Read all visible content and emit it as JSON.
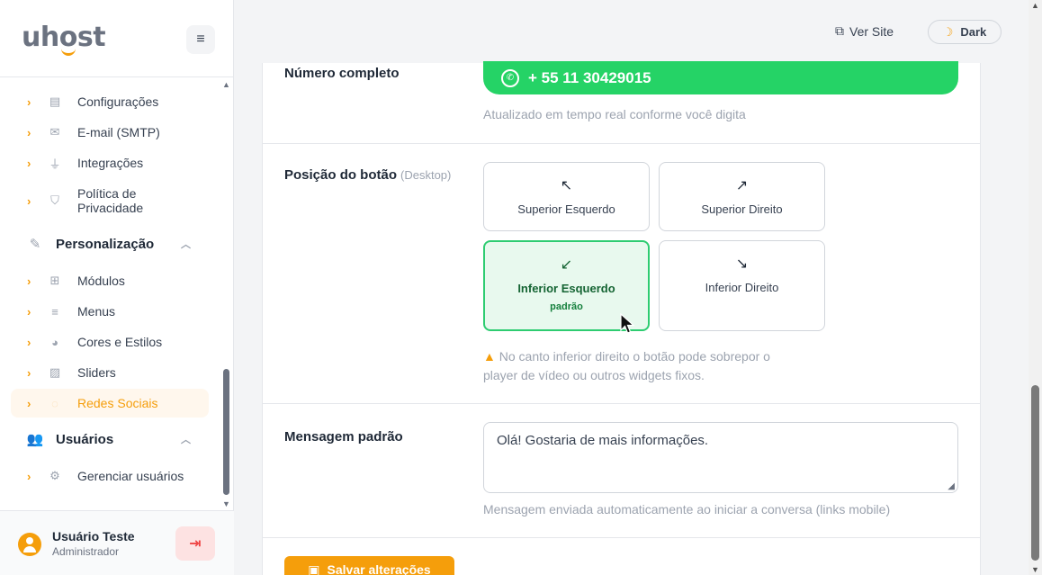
{
  "sidebar": {
    "logo": {
      "prefix": "uh",
      "o": "o",
      "suffix": "st"
    },
    "menu_icon": "hamburger-icon",
    "items": [
      {
        "label": "Configurações",
        "icon": "id-card-icon"
      },
      {
        "label": "E-mail (SMTP)",
        "icon": "envelope-icon"
      },
      {
        "label": "Integrações",
        "icon": "plug-icon"
      },
      {
        "label": "Política de Privacidade",
        "icon": "shield-icon"
      }
    ],
    "section_personalizacao": {
      "label": "Personalização",
      "icon": "brush-icon"
    },
    "personalizacao_items": [
      {
        "label": "Módulos",
        "icon": "grid-icon"
      },
      {
        "label": "Menus",
        "icon": "bars-icon"
      },
      {
        "label": "Cores e Estilos",
        "icon": "palette-icon"
      },
      {
        "label": "Sliders",
        "icon": "images-icon"
      },
      {
        "label": "Redes Sociais",
        "icon": "whatsapp-icon",
        "active": true
      }
    ],
    "section_usuarios": {
      "label": "Usuários",
      "icon": "users-icon"
    },
    "usuarios_items": [
      {
        "label": "Gerenciar usuários",
        "icon": "user-cog-icon"
      }
    ],
    "user": {
      "name": "Usuário Teste",
      "role": "Administrador"
    }
  },
  "topbar": {
    "ver_site": "Ver Site",
    "dark": "Dark"
  },
  "form": {
    "numero": {
      "label": "Número completo",
      "value": "+ 55 11 30429015",
      "hint": "Atualizado em tempo real conforme você digita"
    },
    "posicao": {
      "label": "Posição do botão",
      "sub": "(Desktop)",
      "options": [
        {
          "arrow": "↖",
          "label": "Superior Esquerdo"
        },
        {
          "arrow": "↗",
          "label": "Superior Direito"
        },
        {
          "arrow": "↙",
          "label": "Inferior Esquerdo",
          "tag": "padrão",
          "selected": true
        },
        {
          "arrow": "↘",
          "label": "Inferior Direito"
        }
      ],
      "warning": "No canto inferior direito o botão pode sobrepor o player de vídeo ou outros widgets fixos."
    },
    "mensagem": {
      "label": "Mensagem padrão",
      "value": "Olá! Gostaria de mais informações.",
      "hint": "Mensagem enviada automaticamente ao iniciar a conversa (links mobile)"
    },
    "save_label": "Salvar alterações"
  },
  "colors": {
    "accent": "#f59e0b",
    "whatsapp": "#25d366",
    "selected_border": "#2ecc71",
    "selected_bg": "#e8f9ee"
  }
}
